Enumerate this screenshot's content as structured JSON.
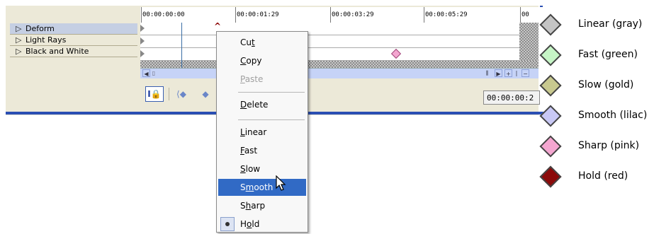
{
  "tracks": [
    {
      "label": "Deform",
      "selected": true
    },
    {
      "label": "Light Rays",
      "selected": false
    },
    {
      "label": "Black and White",
      "selected": false
    }
  ],
  "ruler": {
    "ticks": [
      "00:00:00:00",
      "00:00:01:29",
      "00:00:03:29",
      "00:00:05:29",
      "00"
    ]
  },
  "timecode": "00:00:00:2",
  "lane_keyframe_color": "#f4a6d0",
  "toolbar": {
    "lock_icon": "lock-text-icon",
    "prev_icon": "prev-keyframe-icon",
    "next_icon": "next-keyframe-icon"
  },
  "context_menu": {
    "items": [
      {
        "label": "Cut",
        "accel": "t",
        "disabled": false
      },
      {
        "label": "Copy",
        "accel": "C",
        "disabled": false
      },
      {
        "label": "Paste",
        "accel": "P",
        "disabled": true
      },
      {
        "label": "Delete",
        "accel": "D",
        "disabled": false
      },
      {
        "label": "Linear",
        "accel": "L",
        "disabled": false
      },
      {
        "label": "Fast",
        "accel": "F",
        "disabled": false
      },
      {
        "label": "Slow",
        "accel": "S",
        "disabled": false
      },
      {
        "label": "Smooth",
        "accel": "m",
        "disabled": false,
        "highlighted": true
      },
      {
        "label": "Sharp",
        "accel": "h",
        "disabled": false
      },
      {
        "label": "Hold",
        "accel": "o",
        "disabled": false,
        "checked": true
      }
    ]
  },
  "legend": [
    {
      "label": "Linear (gray)",
      "color": "#c4c4c4"
    },
    {
      "label": "Fast (green)",
      "color": "#c6f5c6"
    },
    {
      "label": "Slow (gold)",
      "color": "#c8c98f"
    },
    {
      "label": "Smooth (lilac)",
      "color": "#c8c8f5"
    },
    {
      "label": "Sharp (pink)",
      "color": "#f4a6d0"
    },
    {
      "label": "Hold (red)",
      "color": "#8b0a0a"
    }
  ],
  "colors": {
    "menu_highlight": "#316ac5",
    "panel_bg": "#ece9d8",
    "accent_blue": "#2b4fb3"
  }
}
